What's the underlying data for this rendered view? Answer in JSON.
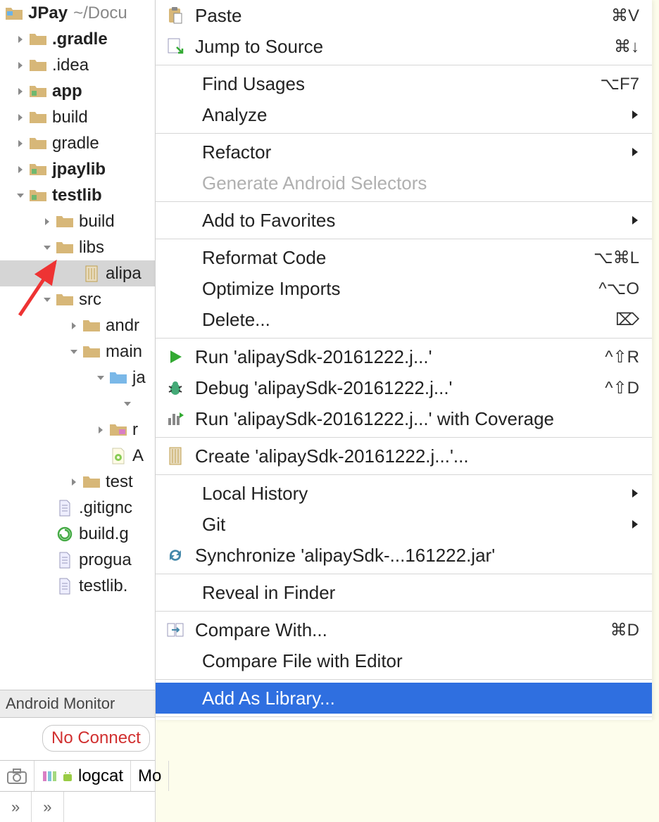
{
  "project": {
    "name": "JPay",
    "path": "~/Docu"
  },
  "tree": [
    {
      "label": ".gradle",
      "indent": 1,
      "arrow": "right",
      "icon": "folder",
      "bold": true
    },
    {
      "label": ".idea",
      "indent": 1,
      "arrow": "right",
      "icon": "folder",
      "bold": false
    },
    {
      "label": "app",
      "indent": 1,
      "arrow": "right",
      "icon": "module",
      "bold": true
    },
    {
      "label": "build",
      "indent": 1,
      "arrow": "right",
      "icon": "folder",
      "bold": false
    },
    {
      "label": "gradle",
      "indent": 1,
      "arrow": "right",
      "icon": "folder",
      "bold": false
    },
    {
      "label": "jpaylib",
      "indent": 1,
      "arrow": "right",
      "icon": "module",
      "bold": true
    },
    {
      "label": "testlib",
      "indent": 1,
      "arrow": "down",
      "icon": "module",
      "bold": true
    },
    {
      "label": "build",
      "indent": 2,
      "arrow": "right",
      "icon": "folder",
      "bold": false
    },
    {
      "label": "libs",
      "indent": 2,
      "arrow": "down",
      "icon": "folder",
      "bold": false
    },
    {
      "label": "alipa",
      "indent": 3,
      "arrow": "",
      "icon": "jar",
      "bold": false,
      "selected": true
    },
    {
      "label": "src",
      "indent": 2,
      "arrow": "down",
      "icon": "folder",
      "bold": false
    },
    {
      "label": "andr",
      "indent": 3,
      "arrow": "right",
      "icon": "folder",
      "bold": false
    },
    {
      "label": "main",
      "indent": 3,
      "arrow": "down",
      "icon": "folder",
      "bold": false
    },
    {
      "label": "ja",
      "indent": 4,
      "arrow": "down",
      "icon": "folder-blue",
      "bold": false
    },
    {
      "label": "",
      "indent": 5,
      "arrow": "down",
      "icon": "",
      "bold": false
    },
    {
      "label": "r",
      "indent": 4,
      "arrow": "right",
      "icon": "folder-res",
      "bold": false
    },
    {
      "label": "A",
      "indent": 4,
      "arrow": "",
      "icon": "xml",
      "bold": false
    },
    {
      "label": "test",
      "indent": 3,
      "arrow": "right",
      "icon": "folder",
      "bold": false
    },
    {
      "label": ".gitignc",
      "indent": 2,
      "arrow": "",
      "icon": "file",
      "bold": false
    },
    {
      "label": "build.g",
      "indent": 2,
      "arrow": "",
      "icon": "gradle",
      "bold": false
    },
    {
      "label": "progua",
      "indent": 2,
      "arrow": "",
      "icon": "file",
      "bold": false
    },
    {
      "label": "testlib.",
      "indent": 2,
      "arrow": "",
      "icon": "file",
      "bold": false
    }
  ],
  "bottom": {
    "monitor": "Android Monitor",
    "noConnect": "No Connect",
    "logcat": "logcat",
    "mo": "Mo"
  },
  "menu": [
    {
      "type": "item",
      "label": "Paste",
      "shortcut": "⌘V",
      "icon": "paste"
    },
    {
      "type": "item",
      "label": "Jump to Source",
      "shortcut": "⌘↓",
      "icon": "jump"
    },
    {
      "type": "sep"
    },
    {
      "type": "item",
      "label": "Find Usages",
      "shortcut": "⌥F7",
      "noicon": true
    },
    {
      "type": "item",
      "label": "Analyze",
      "sub": true,
      "noicon": true
    },
    {
      "type": "sep"
    },
    {
      "type": "item",
      "label": "Refactor",
      "sub": true,
      "noicon": true
    },
    {
      "type": "item",
      "label": "Generate Android Selectors",
      "disabled": true,
      "noicon": true
    },
    {
      "type": "sep"
    },
    {
      "type": "item",
      "label": "Add to Favorites",
      "sub": true,
      "noicon": true
    },
    {
      "type": "sep"
    },
    {
      "type": "item",
      "label": "Reformat Code",
      "shortcut": "⌥⌘L",
      "noicon": true
    },
    {
      "type": "item",
      "label": "Optimize Imports",
      "shortcut": "^⌥O",
      "noicon": true
    },
    {
      "type": "item",
      "label": "Delete...",
      "shortcut": "⌦",
      "noicon": true
    },
    {
      "type": "sep"
    },
    {
      "type": "item",
      "label": "Run 'alipaySdk-20161222.j...'",
      "shortcut": "^⇧R",
      "icon": "run"
    },
    {
      "type": "item",
      "label": "Debug 'alipaySdk-20161222.j...'",
      "shortcut": "^⇧D",
      "icon": "debug"
    },
    {
      "type": "item",
      "label": "Run 'alipaySdk-20161222.j...' with Coverage",
      "icon": "coverage"
    },
    {
      "type": "sep"
    },
    {
      "type": "item",
      "label": "Create 'alipaySdk-20161222.j...'...",
      "icon": "jar"
    },
    {
      "type": "sep"
    },
    {
      "type": "item",
      "label": "Local History",
      "sub": true,
      "noicon": true
    },
    {
      "type": "item",
      "label": "Git",
      "sub": true,
      "noicon": true
    },
    {
      "type": "item",
      "label": "Synchronize 'alipaySdk-...161222.jar'",
      "icon": "sync"
    },
    {
      "type": "sep"
    },
    {
      "type": "item",
      "label": "Reveal in Finder",
      "noicon": true
    },
    {
      "type": "sep"
    },
    {
      "type": "item",
      "label": "Compare With...",
      "shortcut": "⌘D",
      "icon": "compare"
    },
    {
      "type": "item",
      "label": "Compare File with Editor",
      "noicon": true
    },
    {
      "type": "sep"
    },
    {
      "type": "item",
      "label": "Add As Library...",
      "highlight": true,
      "noicon": true
    },
    {
      "type": "sep"
    }
  ]
}
